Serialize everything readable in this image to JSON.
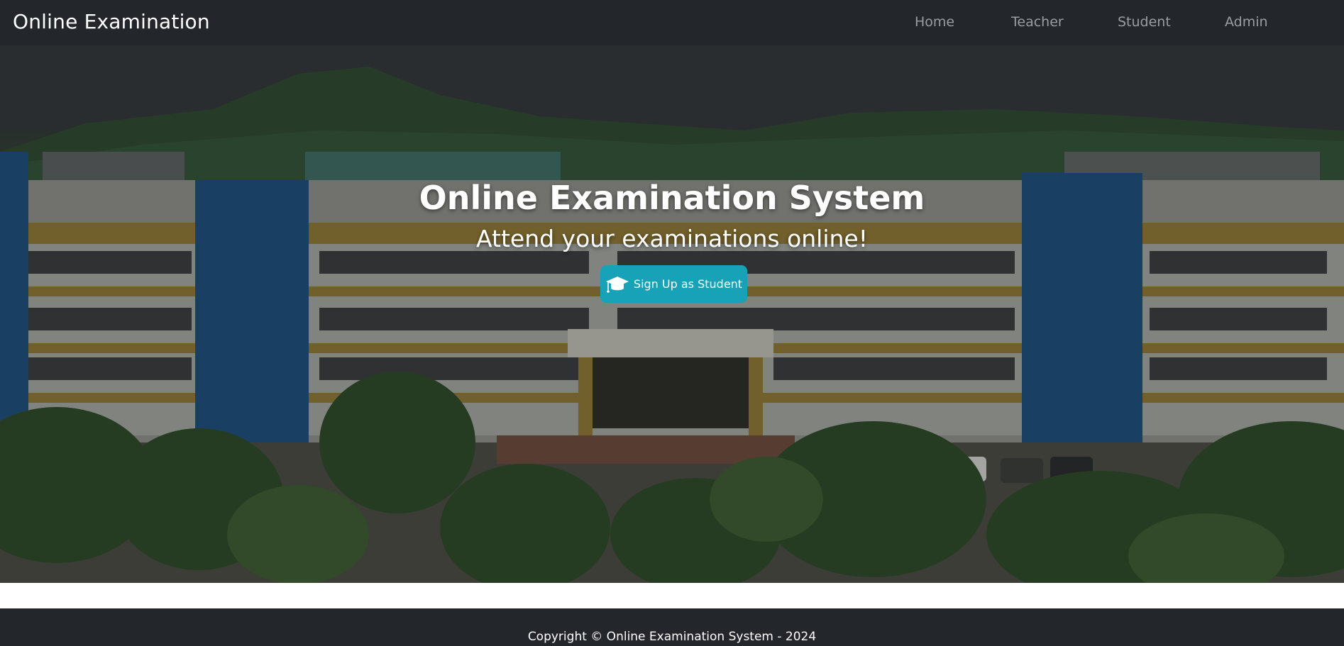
{
  "navbar": {
    "brand": "Online Examination",
    "links": [
      {
        "label": "Home"
      },
      {
        "label": "Teacher"
      },
      {
        "label": "Student"
      },
      {
        "label": "Admin"
      }
    ]
  },
  "hero": {
    "title": "Online Examination System",
    "subtitle": "Attend your examinations online!",
    "signup_button": {
      "label": "Sign Up as Student",
      "icon": "graduation-cap-icon",
      "color": "#17a2b8"
    },
    "background_image": "college-building-photo"
  },
  "footer": {
    "copyright": "Copyright © Online Examination System - 2024"
  },
  "colors": {
    "navbar_bg": "#23272b",
    "nav_link": "#9a9da1",
    "accent": "#17a2b8"
  }
}
